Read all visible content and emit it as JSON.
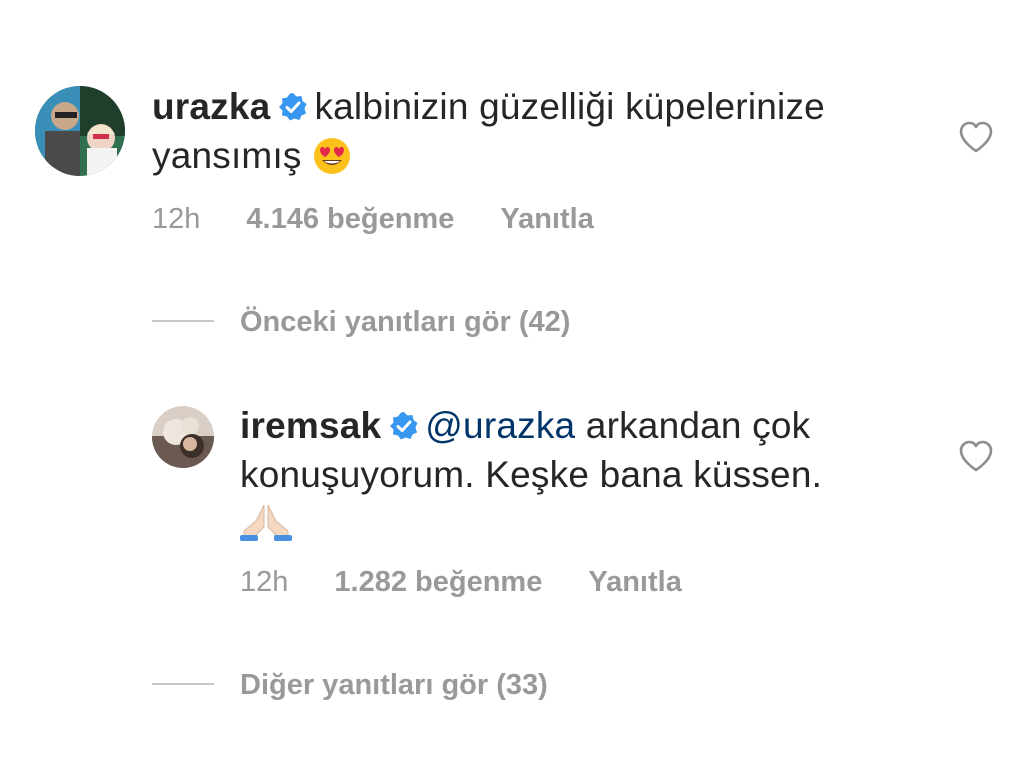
{
  "comment": {
    "username": "urazka",
    "text": "kalbinizin güzelliği küpelerinize yansımış",
    "emoji": "heart-eyes-emoji",
    "time": "12h",
    "likes": "4.146 beğenme",
    "reply_label": "Yanıtla"
  },
  "previous_replies": {
    "label": "Önceki yanıtları gör (42)"
  },
  "reply": {
    "username": "iremsak",
    "mention": "@urazka",
    "text_line1": "arkandan çok",
    "text_line2": "konuşuyorum. Keşke bana küssen.",
    "emoji": "folded-hands-emoji",
    "time": "12h",
    "likes": "1.282 beğenme",
    "reply_label": "Yanıtla"
  },
  "other_replies": {
    "label": "Diğer yanıtları gör (33)"
  },
  "colors": {
    "text": "#262626",
    "meta": "#999999",
    "mention": "#003569",
    "verified": "#3897f0"
  }
}
